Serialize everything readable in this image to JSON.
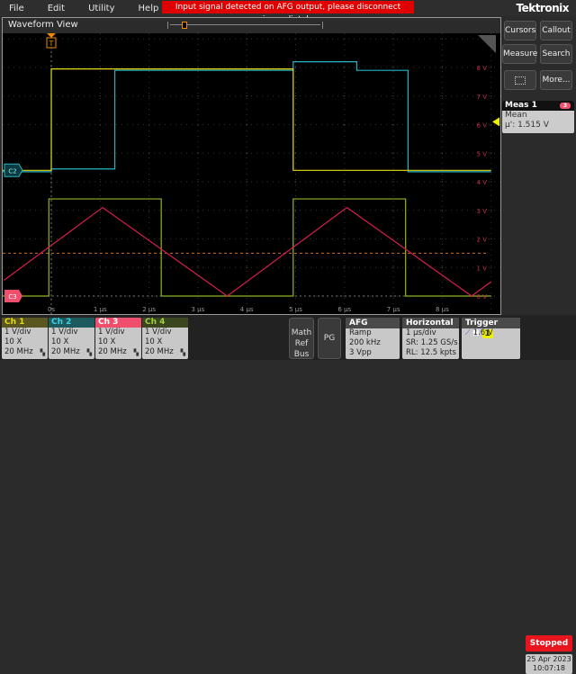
{
  "menu": [
    "File",
    "Edit",
    "Utility",
    "Help"
  ],
  "alert": "Input signal detected on AFG output, please disconnect immediately",
  "logo": "Tektronix",
  "waveform_view": {
    "title": "Waveform View",
    "trigger_marker": "T",
    "ch2_marker": "C2",
    "ch3_marker": "C3",
    "y_labels": [
      "8 V",
      "7 V",
      "6 V",
      "5 V",
      "4 V",
      "3 V",
      "2 V",
      "1 V",
      "0 V"
    ],
    "x_labels": [
      "0s",
      "1 µs",
      "2 µs",
      "3 µs",
      "4 µs",
      "5 µs",
      "6 µs",
      "7 µs",
      "8 µs"
    ],
    "trigger_level_v": 1.5,
    "traces": {
      "ch1": {
        "color": "#e3dc16",
        "points": [
          [
            -1,
            4.4
          ],
          [
            0,
            4.4
          ],
          [
            0,
            7.95
          ],
          [
            4.95,
            7.95
          ],
          [
            4.95,
            4.4
          ],
          [
            9,
            4.4
          ]
        ]
      },
      "ch2": {
        "color": "#26b4c4",
        "points": [
          [
            -1,
            4.35
          ],
          [
            0,
            4.35
          ],
          [
            0,
            4.45
          ],
          [
            1.3,
            4.45
          ],
          [
            1.3,
            7.9
          ],
          [
            4.95,
            7.9
          ],
          [
            4.95,
            8.2
          ],
          [
            6.25,
            8.2
          ],
          [
            6.25,
            7.9
          ],
          [
            7.3,
            7.9
          ],
          [
            7.3,
            4.35
          ],
          [
            9,
            4.35
          ]
        ]
      },
      "ch3": {
        "color": "#d81e4a",
        "points": [
          [
            -0.97,
            0.55
          ],
          [
            1.05,
            3.1
          ],
          [
            3.6,
            0
          ],
          [
            6.05,
            3.1
          ],
          [
            8.6,
            0
          ],
          [
            9,
            0.5
          ]
        ]
      },
      "ch4": {
        "color": "#8fb52a",
        "points": [
          [
            -1,
            0
          ],
          [
            -0.05,
            0
          ],
          [
            -0.05,
            3.4
          ],
          [
            2.25,
            3.4
          ],
          [
            2.25,
            0
          ],
          [
            4.95,
            0
          ],
          [
            4.95,
            3.4
          ],
          [
            7.25,
            3.4
          ],
          [
            7.25,
            0
          ],
          [
            9,
            0
          ]
        ]
      }
    }
  },
  "right_panel": {
    "buttons": [
      "Cursors",
      "Callout",
      "Measure",
      "Search",
      "More..."
    ],
    "meas": {
      "title": "Meas 1",
      "badge": "3",
      "type": "Mean",
      "value": "µ': 1.515 V"
    }
  },
  "channels": [
    {
      "name": "Ch 1",
      "scale": "1 V/div",
      "probe": "10 X",
      "bw": "20 MHz",
      "color": "#e3dc16",
      "bg": "#5b5620"
    },
    {
      "name": "Ch 2",
      "scale": "1 V/div",
      "probe": "10 X",
      "bw": "20 MHz",
      "color": "#3fd0e0",
      "bg": "#1d5a5e"
    },
    {
      "name": "Ch 3",
      "scale": "1 V/div",
      "probe": "10 X",
      "bw": "20 MHz",
      "color": "#ffffff",
      "bg": "#ef4f6c"
    },
    {
      "name": "Ch 4",
      "scale": "1 V/div",
      "probe": "10 X",
      "bw": "20 MHz",
      "color": "#9fd040",
      "bg": "#39461e"
    }
  ],
  "math_ref_bus": [
    "Math",
    "Ref",
    "Bus"
  ],
  "pg": "PG",
  "afg": {
    "title": "AFG",
    "wave": "Ramp",
    "freq": "200 kHz",
    "amp": "3 Vpp"
  },
  "horizontal": {
    "title": "Horizontal",
    "scale": "1 µs/div",
    "sr": "SR: 1.25 GS/s",
    "rl": "RL: 12.5 kpts"
  },
  "trigger": {
    "title": "Trigger",
    "mode": "N",
    "source": "1",
    "level": "1.6 V"
  },
  "status": "Stopped",
  "date": "25 Apr 2023",
  "time": "10:07:18"
}
